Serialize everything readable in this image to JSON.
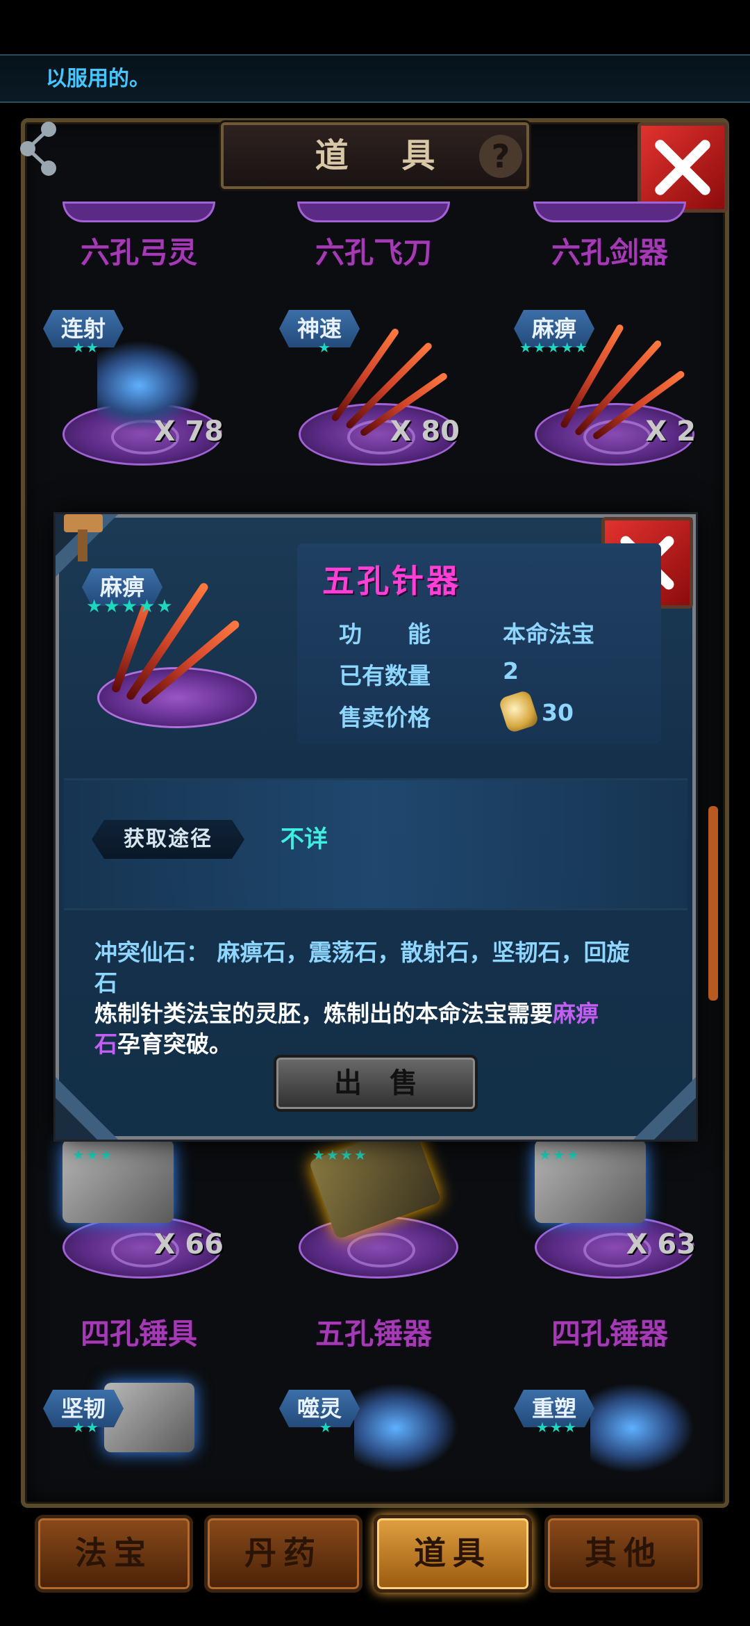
{
  "message": "以服用的。",
  "window": {
    "title": "道 具",
    "help_icon": "?"
  },
  "grid": {
    "top_row_names": [
      "六孔弓灵",
      "六孔飞刀",
      "六孔剑器"
    ],
    "row2": [
      {
        "tag": "连射",
        "stars": "★★",
        "count": "X 78"
      },
      {
        "tag": "神速",
        "stars": "★",
        "count": "X 80"
      },
      {
        "tag": "麻痹",
        "stars": "★★★★★",
        "count": "X 2"
      }
    ],
    "row3": [
      {
        "stars": "★★★",
        "count": "X 66",
        "name": "四孔锤具"
      },
      {
        "stars": "★★★★",
        "count": "",
        "name": "五孔锤器"
      },
      {
        "stars": "★★★",
        "count": "X 63",
        "name": "四孔锤器"
      }
    ],
    "row4": [
      {
        "tag": "坚韧",
        "stars": "★★"
      },
      {
        "tag": "噬灵",
        "stars": "★"
      },
      {
        "tag": "重塑",
        "stars": "★★★"
      }
    ]
  },
  "detail": {
    "tag": "麻痹",
    "stars": "★★★★★",
    "name": "五孔针器",
    "function_label": "功　　能",
    "function_value": "本命法宝",
    "quantity_label": "已有数量",
    "quantity_value": "2",
    "price_label": "售卖价格",
    "price_value": "30",
    "source_label": "获取途径",
    "source_value": "不详",
    "conflict_line1": "冲突仙石：  麻痹石，震荡石，散射石，坚韧石，回旋",
    "conflict_line2": "石",
    "desc_line1_a": "炼制针类法宝的灵胚，炼制出的本命法宝需要",
    "desc_line1_b": "麻痹",
    "desc_line2_a": "石",
    "desc_line2_b": "孕育突破。",
    "sell_label": "出售"
  },
  "tabs": [
    {
      "label": "法宝"
    },
    {
      "label": "丹药"
    },
    {
      "label": "道具"
    },
    {
      "label": "其他"
    }
  ],
  "colors": {
    "accent_pink": "#ff3fd6",
    "item_name_purple": "#a43bb5",
    "info_blue": "#8fd6ff",
    "source_cyan": "#3ff0e0",
    "star_teal": "#1ed7bf"
  }
}
